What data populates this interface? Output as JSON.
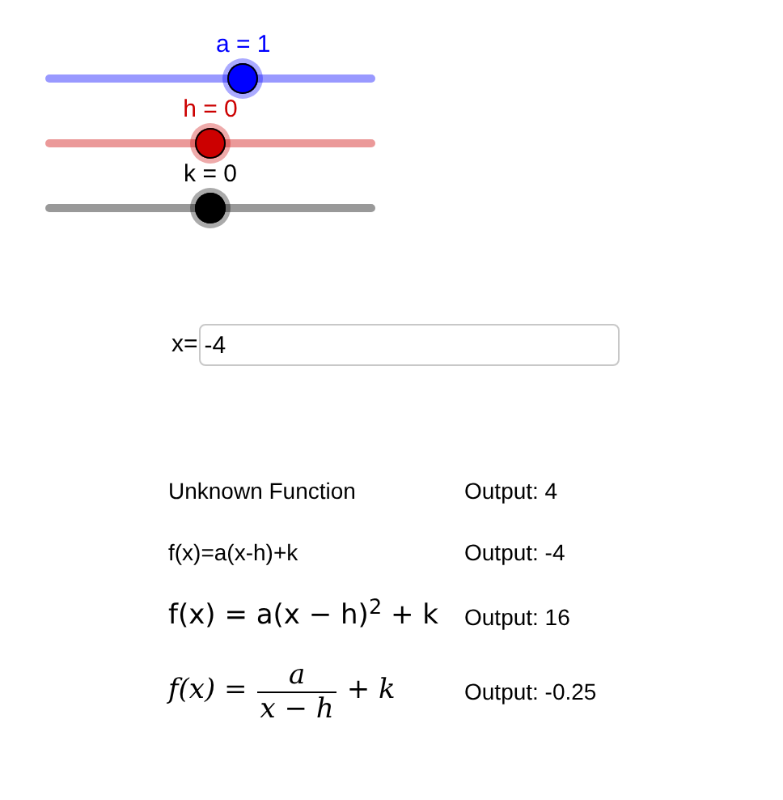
{
  "sliders": [
    {
      "label": "a = 1",
      "level": 0.6,
      "color": "#0000ff"
    },
    {
      "label": "h = 0",
      "level": 0.5,
      "color": "#cc0000"
    },
    {
      "label": "k = 0",
      "level": 0.5,
      "color": "#000000"
    }
  ],
  "input": {
    "label": "x=",
    "value": "-4"
  },
  "functions": [
    {
      "kind": "text",
      "text": "Unknown Function",
      "output": "Output: 4"
    },
    {
      "kind": "text",
      "text": "f(x)=a(x-h)+k",
      "output": "Output: -4"
    },
    {
      "kind": "formula",
      "text": "f(x) = a(x − h)$^{2}$ + k",
      "output": "Output: 16"
    },
    {
      "kind": "fraction",
      "prefix": "f(x) =",
      "numerator": "a",
      "denominator": "x − h",
      "suffix": "+ k",
      "output": "Output: -0.25"
    }
  ]
}
